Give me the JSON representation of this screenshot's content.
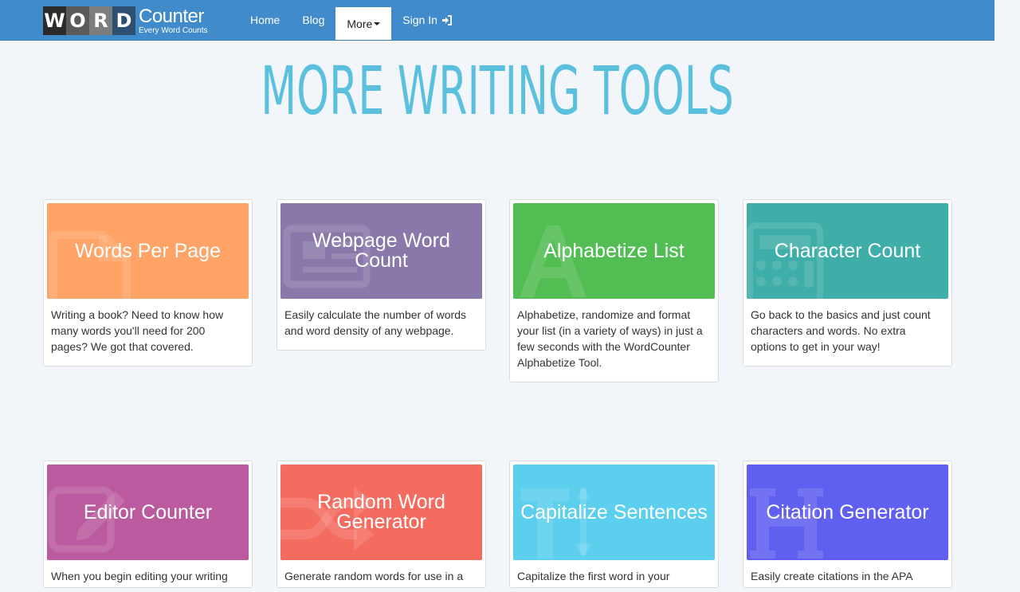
{
  "logo": {
    "letters": [
      "W",
      "O",
      "R",
      "D"
    ],
    "letter_colors": [
      "#2b2b2b",
      "#5a5a5a",
      "#7d7d7d",
      "#2e4e72"
    ],
    "main": "Counter",
    "tagline": "Every Word Counts"
  },
  "nav": {
    "home": "Home",
    "blog": "Blog",
    "more": "More",
    "signin": "Sign In"
  },
  "page": {
    "title": "MORE WRITING TOOLS"
  },
  "cards": [
    {
      "title": "Words Per Page",
      "color": "#ffa366",
      "icon": "document-icon",
      "desc": "Writing a book? Need to know how many words you'll need for 200 pages? We got that covered."
    },
    {
      "title": "Webpage Word Count",
      "color": "#8a78aa",
      "icon": "newspaper-icon",
      "desc": "Easily calculate the number of words and word density of any webpage."
    },
    {
      "title": "Alphabetize List",
      "color": "#52bd52",
      "icon": "letter-a-icon",
      "desc": "Alphabetize, randomize and format your list (in a variety of ways) in just a few seconds with the WordCounter Alphabetize Tool."
    },
    {
      "title": "Character Count",
      "color": "#3fada8",
      "icon": "calculator-icon",
      "desc": "Go back to the basics and just count characters and words. No extra options to get in your way!"
    },
    {
      "title": "Editor Counter",
      "color": "#bb5a9e",
      "icon": "edit-icon",
      "desc": "When you begin editing your writing"
    },
    {
      "title": "Random Word Generator",
      "color": "#f46c60",
      "icon": "shuffle-icon",
      "desc": "Generate random words for use in a"
    },
    {
      "title": "Capitalize Sentences",
      "color": "#5ccfee",
      "icon": "text-height-icon",
      "desc": "Capitalize the first word in your"
    },
    {
      "title": "Citation Generator",
      "color": "#6060f0",
      "icon": "header-icon",
      "desc": "Easily create citations in the APA"
    }
  ]
}
